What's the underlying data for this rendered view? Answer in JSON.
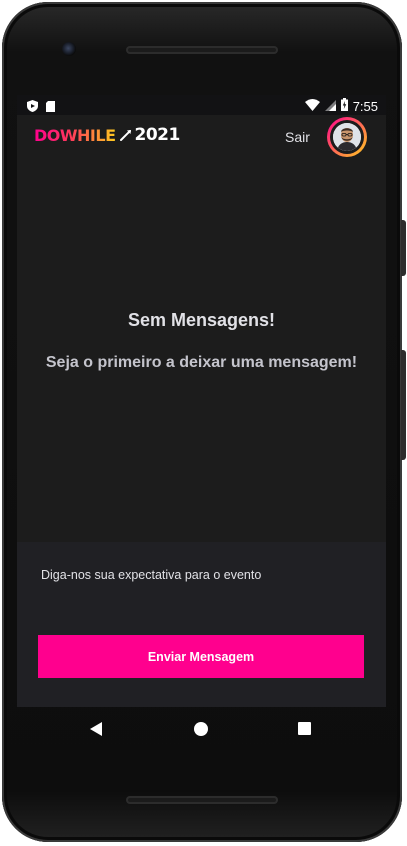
{
  "status_bar": {
    "time": "7:55",
    "left_icons": [
      "shield-icon",
      "sd-card-icon"
    ],
    "right_icons": [
      "wifi-icon",
      "signal-icon",
      "battery-charging-icon"
    ]
  },
  "app_bar": {
    "logo_main": "DOWHILE",
    "logo_year": "2021",
    "logout_label": "Sair",
    "avatar_icon": "user-avatar"
  },
  "empty_state": {
    "title": "Sem Mensagens!",
    "subtitle": "Seja o primeiro a deixar uma mensagem!"
  },
  "message_form": {
    "placeholder": "Diga-nos sua expectativa para o evento",
    "value": "",
    "submit_label": "Enviar Mensagem"
  },
  "nav_bar": {
    "icons": [
      "back-icon",
      "home-icon",
      "recents-icon"
    ]
  },
  "colors": {
    "accent": "#ff008e",
    "gradient_end": "#ffcd1e",
    "background": "#1c1c1c",
    "form_background": "#202024",
    "text_primary": "#e1e1e6"
  }
}
